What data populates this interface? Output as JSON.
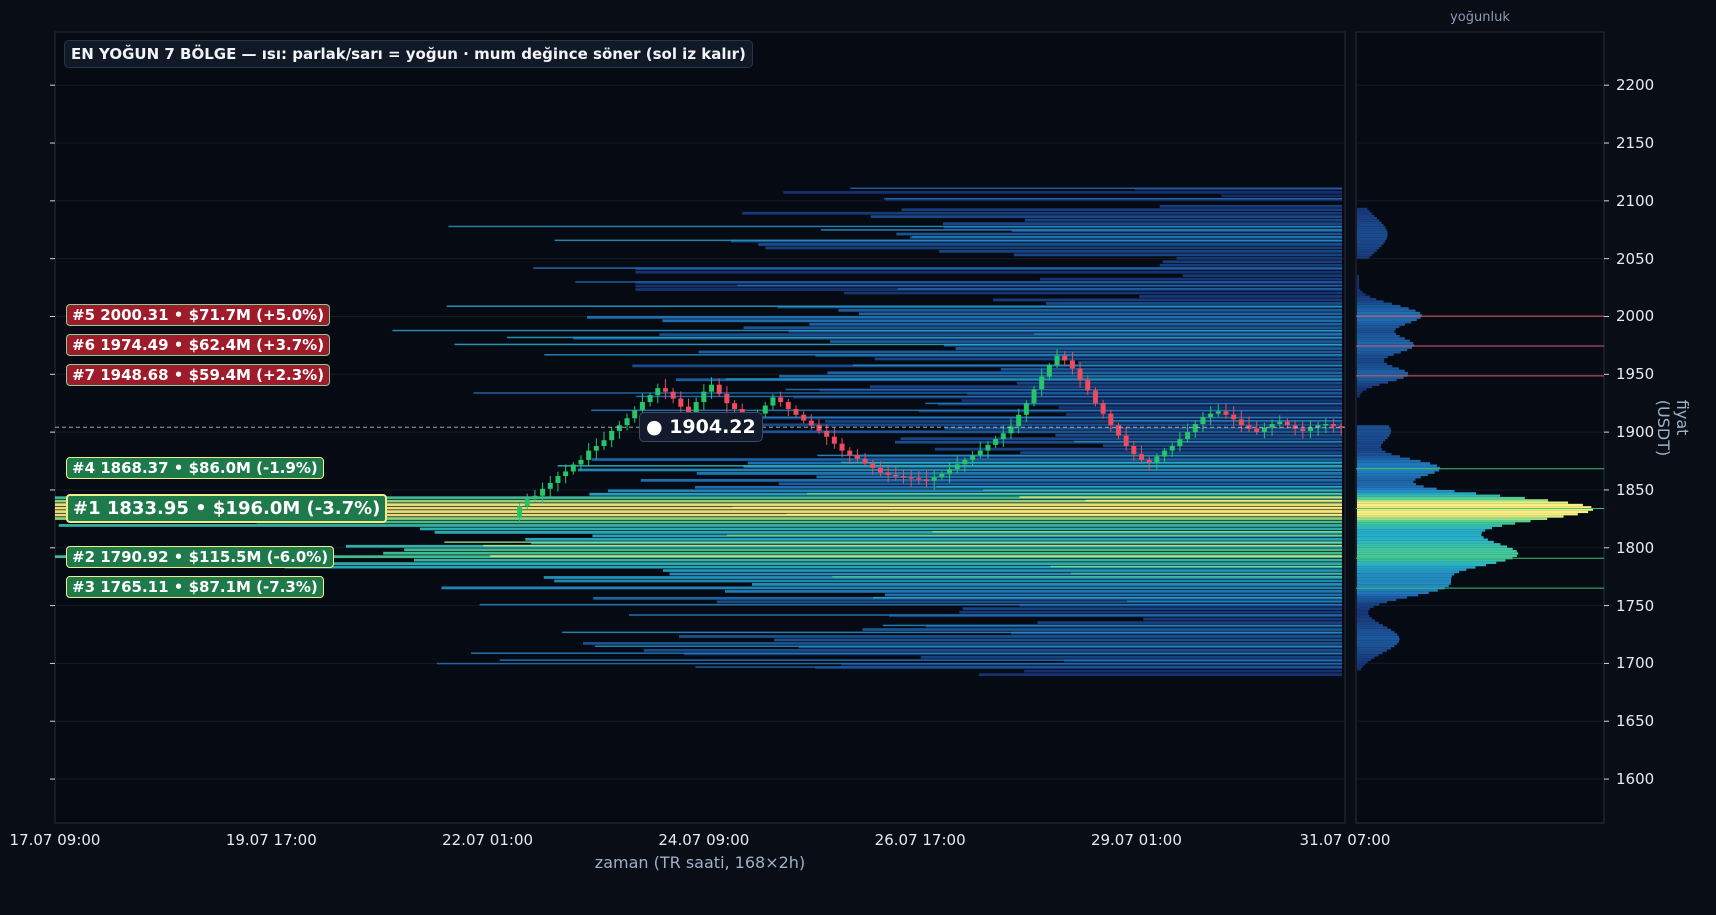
{
  "chart_data": {
    "type": "heatmap",
    "title": "EN YOĞUN 7 BÖLGE — ısı: parlak/sarı = yoğun · mum değince söner (sol iz kalır)",
    "xlabel": "zaman (TR saati, 168×2h)",
    "ylabel": "fiyat (USDT)",
    "profile_title": "yoğunluk",
    "x_ticks": [
      "17.07 09:00",
      "19.07 17:00",
      "22.07 01:00",
      "24.07 09:00",
      "26.07 17:00",
      "29.07 01:00",
      "31.07 07:00"
    ],
    "y_ticks": [
      1600,
      1650,
      1700,
      1750,
      1800,
      1850,
      1900,
      1950,
      2000,
      2050,
      2100,
      2150,
      2200
    ],
    "ylim": [
      1562,
      2246
    ],
    "x_range_bars": 168,
    "current_price": 1904.22,
    "current_price_label": "● 1904.22",
    "zones": [
      {
        "rank": 1,
        "label": "#1  1833.95  •  $196.0M  (-3.7%)",
        "price": 1833.95,
        "value_musd": 196.0,
        "pct": -3.7,
        "side": "below"
      },
      {
        "rank": 2,
        "label": "#2  1790.92  •  $115.5M  (-6.0%)",
        "price": 1790.92,
        "value_musd": 115.5,
        "pct": -6.0,
        "side": "below"
      },
      {
        "rank": 3,
        "label": "#3  1765.11  •  $87.1M  (-7.3%)",
        "price": 1765.11,
        "value_musd": 87.1,
        "pct": -7.3,
        "side": "below"
      },
      {
        "rank": 4,
        "label": "#4  1868.37  •  $86.0M  (-1.9%)",
        "price": 1868.37,
        "value_musd": 86.0,
        "pct": -1.9,
        "side": "below"
      },
      {
        "rank": 5,
        "label": "#5  2000.31  •  $71.7M  (+5.0%)",
        "price": 2000.31,
        "value_musd": 71.7,
        "pct": 5.0,
        "side": "above"
      },
      {
        "rank": 6,
        "label": "#6  1974.49  •  $62.4M  (+3.7%)",
        "price": 1974.49,
        "value_musd": 62.4,
        "pct": 3.7,
        "side": "above"
      },
      {
        "rank": 7,
        "label": "#7  1948.68  •  $59.4M  (+2.3%)",
        "price": 1948.68,
        "value_musd": 59.4,
        "pct": 2.3,
        "side": "above"
      }
    ],
    "candle_path": [
      1826,
      1836,
      1842,
      1845,
      1851,
      1856,
      1862,
      1866,
      1872,
      1876,
      1884,
      1888,
      1893,
      1901,
      1906,
      1912,
      1919,
      1926,
      1932,
      1938,
      1935,
      1929,
      1922,
      1917,
      1926,
      1935,
      1941,
      1933,
      1925,
      1920,
      1914,
      1910,
      1916,
      1923,
      1930,
      1926,
      1920,
      1915,
      1910,
      1906,
      1901,
      1896,
      1890,
      1884,
      1880,
      1877,
      1873,
      1869,
      1865,
      1863,
      1862,
      1861,
      1860,
      1859,
      1858,
      1861,
      1864,
      1868,
      1872,
      1876,
      1880,
      1884,
      1889,
      1894,
      1899,
      1905,
      1915,
      1925,
      1937,
      1948,
      1958,
      1966,
      1962,
      1955,
      1945,
      1936,
      1925,
      1916,
      1906,
      1897,
      1888,
      1881,
      1876,
      1874,
      1879,
      1884,
      1888,
      1894,
      1900,
      1907,
      1913,
      1916,
      1918,
      1915,
      1911,
      1906,
      1903,
      1900,
      1904,
      1907,
      1909,
      1906,
      1903,
      1901,
      1904,
      1906,
      1907,
      1905,
      1904.22
    ],
    "colors": {
      "background": "#090d15",
      "up": "#26c56a",
      "down": "#ee4b5e",
      "heat_low": "#1d3a7a",
      "heat_mid": "#2ab0cf",
      "heat_high": "#f6ee78",
      "zone_above": "#9e1b2a",
      "zone_below": "#1e7a4a"
    },
    "grid": true
  }
}
